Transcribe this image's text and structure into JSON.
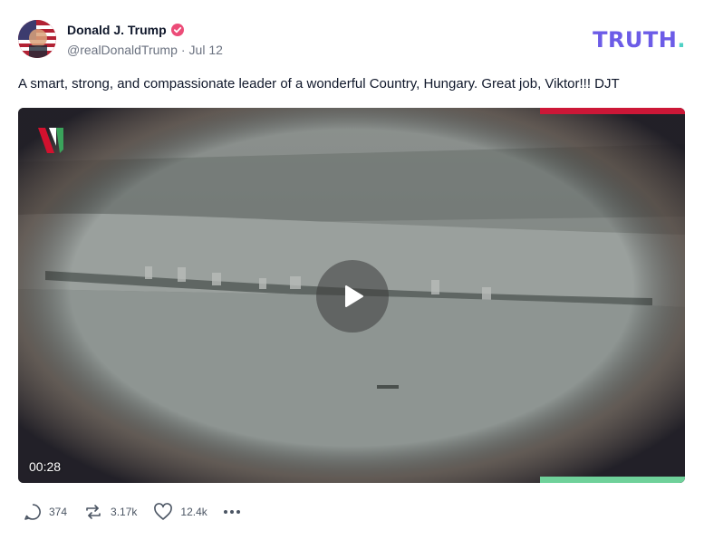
{
  "author": {
    "name": "Donald J. Trump",
    "handle": "@realDonaldTrump",
    "separator": "·",
    "date": "Jul 12",
    "verified_color": "#ec4c78"
  },
  "brand": {
    "logo_text": "TRUTH",
    "logo_dot": ".",
    "color": "#6c5ce7",
    "dot_color": "#4fd1c5"
  },
  "post": {
    "text": "A smart, strong, and compassionate leader of a wonderful Country, Hungary. Great job, Viktor!!! DJT"
  },
  "video": {
    "duration": "00:28",
    "progress_top_color": "#cc1737",
    "progress_bottom_color": "#6fd19a"
  },
  "actions": {
    "replies": "374",
    "retruths": "3.17k",
    "likes": "12.4k"
  },
  "icons": [
    "verified-badge-icon",
    "play-icon",
    "reply-icon",
    "retruth-icon",
    "like-icon",
    "more-icon"
  ]
}
